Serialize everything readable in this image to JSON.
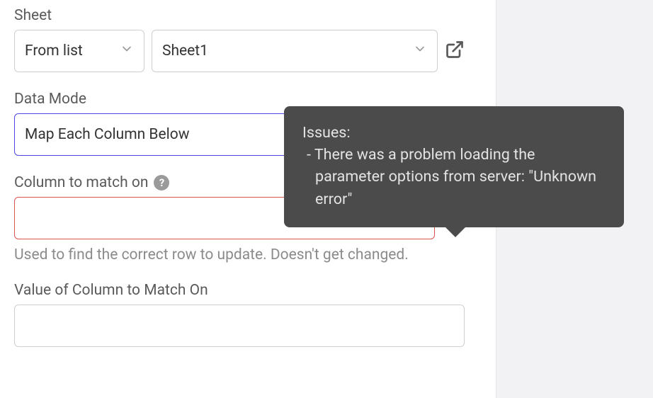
{
  "sheet": {
    "label": "Sheet",
    "mode_value": "From list",
    "value": "Sheet1"
  },
  "data_mode": {
    "label": "Data Mode",
    "value": "Map Each Column Below"
  },
  "column_match": {
    "label": "Column to match on",
    "value": "",
    "helper": "Used to find the correct row to update. Doesn't get changed."
  },
  "value_match": {
    "label": "Value of Column to Match On",
    "value": ""
  },
  "tooltip": {
    "heading": "Issues:",
    "line1": " - There was a problem loading the parameter options from server: \"Unknown error\""
  }
}
